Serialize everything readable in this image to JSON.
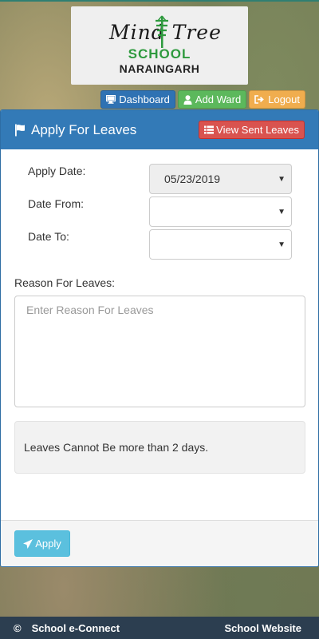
{
  "logo": {
    "script_text": "Mind Tree",
    "school": "SCHOOL",
    "city": "NARAINGARH"
  },
  "nav": {
    "dashboard": "Dashboard",
    "add_ward": "Add Ward",
    "logout": "Logout"
  },
  "panel": {
    "title": "Apply For Leaves",
    "view_sent_label": "View Sent Leaves"
  },
  "form": {
    "apply_date_label": "Apply Date:",
    "apply_date_value": "05/23/2019",
    "date_from_label": "Date From:",
    "date_from_value": "",
    "date_to_label": "Date To:",
    "date_to_value": "",
    "reason_label": "Reason For Leaves:",
    "reason_placeholder": "Enter Reason For Leaves",
    "note": "Leaves Cannot Be more than 2 days.",
    "apply_label": "Apply"
  },
  "footer": {
    "copyright": "©",
    "brand": "School e-Connect",
    "link": "School Website"
  },
  "colors": {
    "primary": "#337ab7",
    "danger": "#d9534f",
    "success": "#5cb85c",
    "warning": "#f0ad4e",
    "info": "#5bc0de",
    "footer": "#2c3e50"
  },
  "icons": {
    "dashboard": "desktop-icon",
    "add_ward": "user-icon",
    "logout": "sign-out-icon",
    "panel": "flag-icon",
    "view_sent": "list-icon",
    "apply": "send-icon"
  }
}
